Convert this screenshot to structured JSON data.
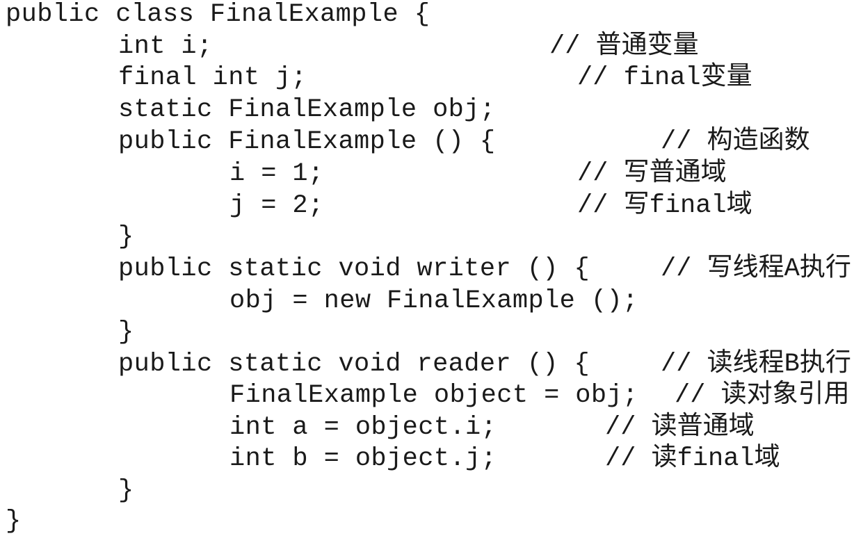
{
  "code_lines": [
    {
      "code": "public class FinalExample {",
      "comment": null
    },
    {
      "code": "int i;",
      "comment": "// 普通变量"
    },
    {
      "code": "final int j;",
      "comment": "// final变量"
    },
    {
      "code": "static FinalExample obj;",
      "comment": null
    },
    {
      "code": "public FinalExample () {",
      "comment": "// 构造函数"
    },
    {
      "code": "i = 1;",
      "comment": "// 写普通域"
    },
    {
      "code": "j = 2;",
      "comment": "// 写final域"
    },
    {
      "code": "}",
      "comment": null
    },
    {
      "code": "public static void writer () {",
      "comment": "// 写线程A执行"
    },
    {
      "code": "obj = new FinalExample ();",
      "comment": null
    },
    {
      "code": "}",
      "comment": null
    },
    {
      "code": "public static void reader () {",
      "comment": "// 读线程B执行"
    },
    {
      "code": "FinalExample object = obj;",
      "comment": "// 读对象引用"
    },
    {
      "code": "int a = object.i;",
      "comment": "// 读普通域"
    },
    {
      "code": "int b = object.j;",
      "comment": "// 读final域"
    },
    {
      "code": "}",
      "comment": null
    },
    {
      "code": "}",
      "comment": null
    }
  ]
}
